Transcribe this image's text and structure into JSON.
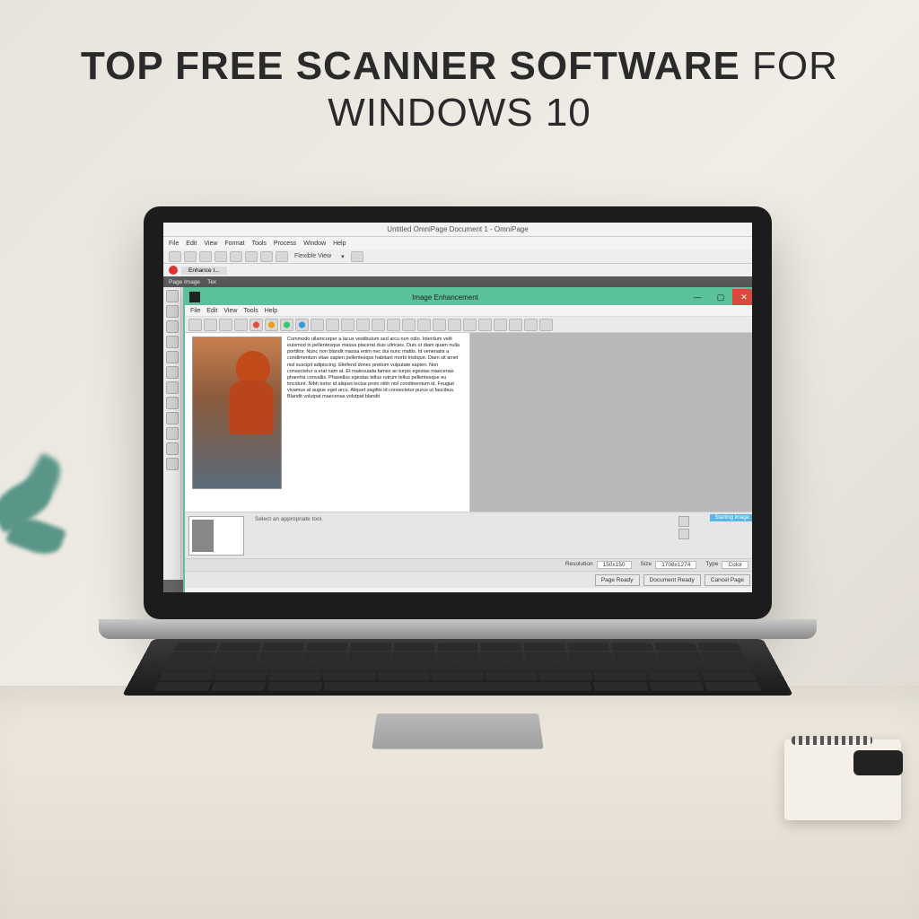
{
  "headline": {
    "bold": "TOP FREE SCANNER SOFTWARE",
    "light": " FOR WINDOWS 10"
  },
  "app": {
    "title": "Untitled OmniPage Document 1 - OmniPage",
    "menu": [
      "File",
      "Edit",
      "View",
      "Format",
      "Tools",
      "Process",
      "Window",
      "Help"
    ],
    "viewMode": "Flexible View",
    "workflowTab": "Enhance I...",
    "pageRibbon": [
      "Page Image",
      "Tex"
    ]
  },
  "dialog": {
    "title": "Image Enhancement",
    "menu": [
      "File",
      "Edit",
      "View",
      "Tools",
      "Help"
    ],
    "lorem": "Commodo ullamcorper a lacus vestibulum sed arcu non odio. Interdum velit euismod in pellentesque massa placerat duis ultricies. Duis ut diam quam nulla porttitor. Nunc non blandit massa enim nec dui nunc mattis. Id venenatis a condimentum vitae sapien pellentesque habitant morbi tristique. Diam sit amet nisl suscipit adipiscing. Eleifend donec pretium vulputate sapien. Non consectetur a erat nam at. Et malesuada fames ac turpis egestas maecenas pharetra convallis. Phasellus egestas tellus rutrum tellus pellentesque eu tincidunt. Nibh tortor id aliquet lectus proin nibh nisl condimentum id. Feugiat vivamus at augue eget arcu. Aliquet sagittis id consectetur purus ut faucibus. Blandit volutpat maecenas volutpat blandit",
    "historyHint": "Select an appropriate tool.",
    "historyBadge": "Starting image",
    "status": {
      "resolutionLabel": "Resolution",
      "resolution": "150x150",
      "sizeLabel": "Size",
      "size": "1708x1274",
      "typeLabel": "Type",
      "type": "Color"
    },
    "buttons": {
      "pageReady": "Page Ready",
      "docReady": "Document Ready",
      "cancel": "Cancel Page"
    }
  }
}
